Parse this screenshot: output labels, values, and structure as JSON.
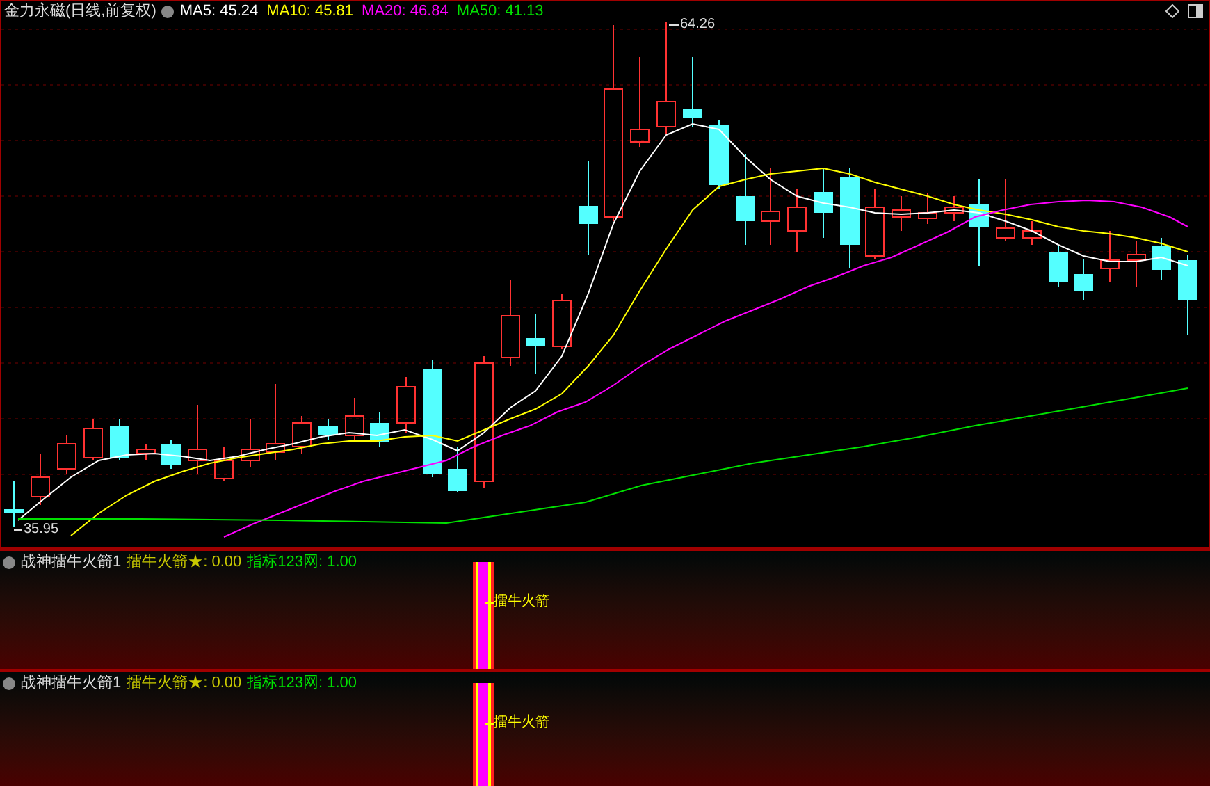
{
  "main_chart": {
    "title": "金力永磁(日线,前复权)",
    "ma_legend": [
      {
        "label": "MA5: 45.24",
        "color": "#ffffff"
      },
      {
        "label": "MA10: 45.81",
        "color": "#ffff00"
      },
      {
        "label": "MA20: 46.84",
        "color": "#ff00ff"
      },
      {
        "label": "MA50: 41.13",
        "color": "#00e000"
      }
    ],
    "high_label": "64.26",
    "low_label": "35.95"
  },
  "indicator_panels": [
    {
      "name": "战神擂牛火箭1",
      "legend": [
        {
          "label": "擂牛火箭★: 0.00",
          "color": "#c8c800"
        },
        {
          "label": "指标123网: 1.00",
          "color": "#00e000"
        }
      ],
      "signal_label": "擂牛火箭"
    },
    {
      "name": "战神擂牛火箭1",
      "legend": [
        {
          "label": "擂牛火箭★: 0.00",
          "color": "#c8c800"
        },
        {
          "label": "指标123网: 1.00",
          "color": "#00e000"
        }
      ],
      "signal_label": "擂牛火箭"
    }
  ]
}
